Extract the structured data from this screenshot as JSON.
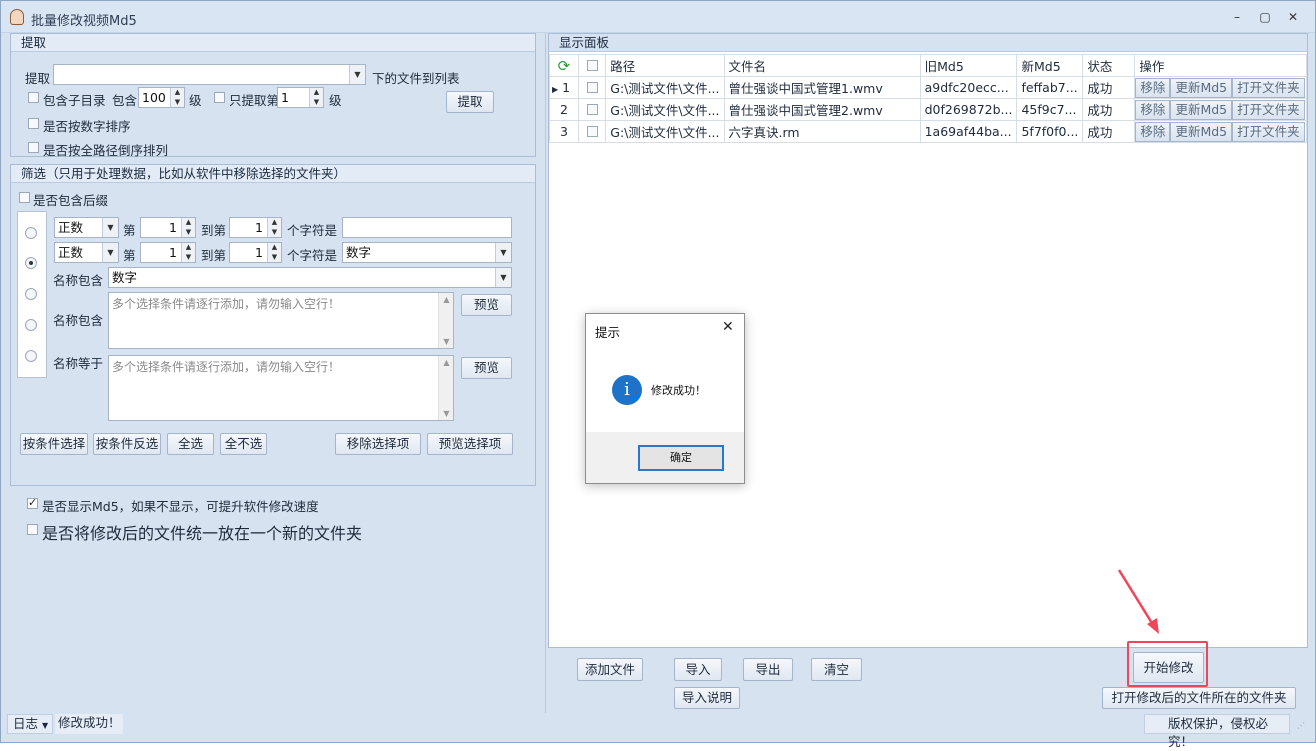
{
  "window": {
    "title": "批量修改视频Md5",
    "minimize": "–",
    "maximize": "▢",
    "close": "✕"
  },
  "extract": {
    "header": "提取",
    "label": "提取",
    "path_value": "",
    "suffix": "下的文件到列表",
    "include_sub": "包含子目录",
    "include_prefix": "包含",
    "level_value": "100",
    "level_unit": "级",
    "only_extract": "只提取第",
    "only_value": "1",
    "only_unit": "级",
    "button": "提取",
    "sort_num": "是否按数字排序",
    "sort_path": "是否按全路径倒序排列"
  },
  "filter": {
    "header": "筛选（只用于处理数据，比如从软件中移除选择的文件夹）",
    "include_suffix": "是否包含后缀",
    "row1": {
      "mode": "正数",
      "di": "第",
      "from": "1",
      "to_label": "到第",
      "to": "1",
      "char_is": "个字符是",
      "value": ""
    },
    "row2": {
      "mode": "正数",
      "di": "第",
      "from": "1",
      "to_label": "到第",
      "to": "1",
      "char_is": "个字符是",
      "value": "数字"
    },
    "name_contains_label": "名称包含",
    "name_contains_value": "数字",
    "name_contains2_label": "名称包含",
    "name_equals_label": "名称等于",
    "placeholder": "多个选择条件请逐行添加，请勿输入空行！",
    "preview": "预览",
    "btn_select": "按条件选择",
    "btn_invert": "按条件反选",
    "btn_all": "全选",
    "btn_none": "全不选",
    "btn_remove": "移除选择项",
    "btn_preview_sel": "预览选择项"
  },
  "options": {
    "show_md5": "是否显示Md5，如果不显示，可提升软件修改速度",
    "unify_folder": "是否将修改后的文件统一放在一个新的文件夹"
  },
  "panel": {
    "header": "显示面板",
    "columns": [
      "",
      "",
      "路径",
      "文件名",
      "旧Md5",
      "新Md5",
      "状态",
      "操作"
    ],
    "rows": [
      {
        "no": "1",
        "path": "G:\\测试文件\\文件...",
        "name": "曾仕强谈中国式管理1.wmv",
        "old": "a9dfc20ecc...",
        "new": "feffab7...",
        "status": "成功"
      },
      {
        "no": "2",
        "path": "G:\\测试文件\\文件...",
        "name": "曾仕强谈中国式管理2.wmv",
        "old": "d0f269872b...",
        "new": "45f9c7...",
        "status": "成功"
      },
      {
        "no": "3",
        "path": "G:\\测试文件\\文件...",
        "name": "六字真诀.rm",
        "old": "1a69af44ba...",
        "new": "5f7f0f0...",
        "status": "成功"
      }
    ],
    "op_remove": "移除",
    "op_update": "更新Md5",
    "op_open": "打开文件夹"
  },
  "bottom": {
    "add_file": "添加文件",
    "import": "导入",
    "export": "导出",
    "clear": "清空",
    "import_help": "导入说明",
    "start": "开始修改",
    "open_folder": "打开修改后的文件所在的文件夹"
  },
  "dialog": {
    "title": "提示",
    "message": "修改成功！",
    "ok": "确定",
    "icon": "i"
  },
  "status": {
    "log": "日志",
    "message": "修改成功！",
    "copyright": "版权保护，侵权必究！"
  },
  "colors": {
    "accent_red": "#f0465a",
    "info_blue": "#1e73c9"
  }
}
